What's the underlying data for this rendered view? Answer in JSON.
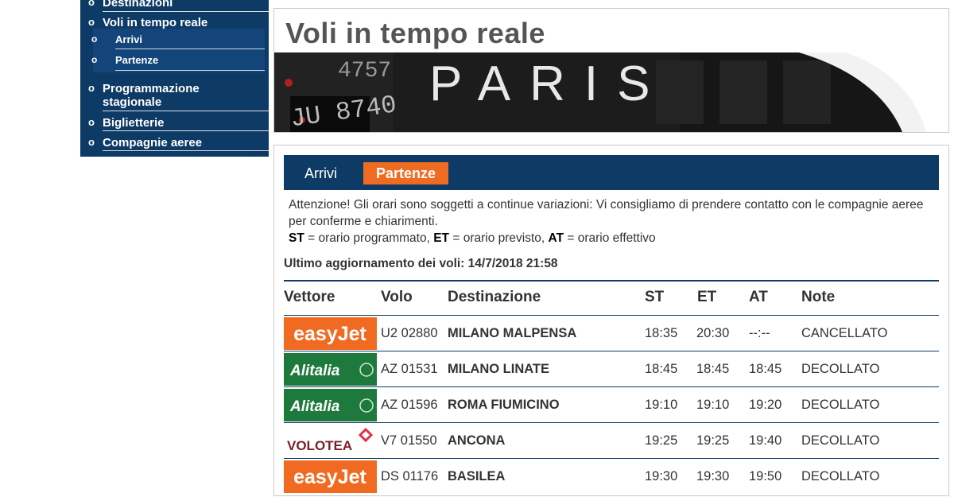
{
  "sidebar": {
    "items": [
      {
        "label": "Destinazioni"
      },
      {
        "label": "Voli in tempo reale"
      },
      {
        "label": "Programmazione stagionale"
      },
      {
        "label": "Biglietterie"
      },
      {
        "label": "Compagnie aeree"
      }
    ],
    "subitems": [
      {
        "label": "Arrivi"
      },
      {
        "label": "Partenze"
      }
    ]
  },
  "header": {
    "title": "Voli in tempo reale",
    "banner_text": "PARIS"
  },
  "tabs": [
    {
      "label": "Arrivi"
    },
    {
      "label": "Partenze",
      "active": true
    }
  ],
  "notice": {
    "text": "Attenzione! Gli orari sono soggetti a continue variazioni: Vi consigliamo di prendere contatto con le compagnie aeree per conferme e chiarimenti.",
    "legend": [
      {
        "key": "ST",
        "desc": "orario programmato"
      },
      {
        "key": "ET",
        "desc": "orario previsto"
      },
      {
        "key": "AT",
        "desc": "orario effettivo"
      }
    ]
  },
  "updated_label": "Ultimo aggiornamento dei voli: 14/7/2018 21:58",
  "table": {
    "headers": [
      "Vettore",
      "Volo",
      "Destinazione",
      "ST",
      "ET",
      "AT",
      "Note"
    ],
    "rows": [
      {
        "carrier": "easyJet",
        "flight": "U2 02880",
        "dest": "MILANO MALPENSA",
        "st": "18:35",
        "et": "20:30",
        "at": "--:--",
        "note": "CANCELLATO"
      },
      {
        "carrier": "Alitalia",
        "flight": "AZ 01531",
        "dest": "MILANO LINATE",
        "st": "18:45",
        "et": "18:45",
        "at": "18:45",
        "note": "DECOLLATO"
      },
      {
        "carrier": "Alitalia",
        "flight": "AZ 01596",
        "dest": "ROMA FIUMICINO",
        "st": "19:10",
        "et": "19:10",
        "at": "19:20",
        "note": "DECOLLATO"
      },
      {
        "carrier": "VOLOTEA",
        "flight": "V7 01550",
        "dest": "ANCONA",
        "st": "19:25",
        "et": "19:25",
        "at": "19:40",
        "note": "DECOLLATO"
      },
      {
        "carrier": "easyJet",
        "flight": "DS 01176",
        "dest": "BASILEA",
        "st": "19:30",
        "et": "19:30",
        "at": "19:50",
        "note": "DECOLLATO"
      }
    ]
  },
  "colors": {
    "navy": "#0e3a66",
    "orange": "#ef6b22",
    "easyjet": "#f16a21",
    "alitalia": "#1e7a3c"
  }
}
